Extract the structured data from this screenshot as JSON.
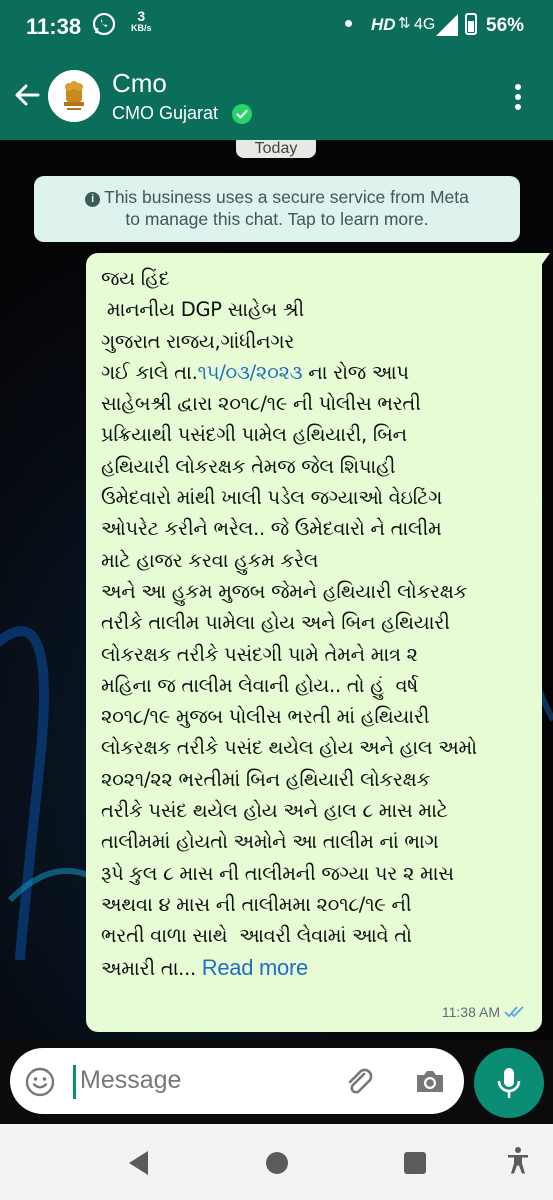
{
  "status_bar": {
    "time": "11:38",
    "net_speed_value": "3",
    "net_speed_unit": "KB/s",
    "hd": "HD",
    "network": "4G",
    "battery": "56%"
  },
  "header": {
    "title": "Cmo",
    "subtitle": "CMO Gujarat",
    "back_icon": "arrow-left-icon",
    "menu_icon": "more-vertical-icon"
  },
  "chat": {
    "date_chip": "Today",
    "notice": {
      "line1": "This business uses a secure service from Meta",
      "line2": "to manage this chat. Tap to learn more."
    },
    "message": {
      "lines": [
        "જય હિંદ",
        " માનનીય DGP સાહેબ શ્રી",
        "ગુજરાત રાજય,ગાંધીનગર",
        "ગઈ કાલે તા.",
        "૧૫/૦૩/૨૦૨૩",
        " ના રોજ આપ",
        "સાહેબશ્રી દ્વારા ૨૦૧૮/૧૯ ની પોલીસ ભરતી",
        "પ્રક્રિયાથી પસંદગી પામેલ હથિયારી, બિન",
        "હથિયારી લોકરક્ષક તેમજ જેલ શિપાહી",
        "ઉમેદવારો માંથી ખાલી પડેલ જગ્યાઓ વેઇટિંગ",
        "ઓપરેટ કરીને ભરેલ.. જે ઉમેદવારો ને તાલીમ",
        "માટે હાજર કરવા હુકમ કરેલ",
        "અને આ હુકમ મુજબ જેમને હથિયારી લોકરક્ષક",
        "તરીકે તાલીમ પામેલા હોય અને બિન હથિયારી",
        "લોકરક્ષક તરીકે પસંદગી પામે તેમને માત્ર ૨",
        "મહિના જ તાલીમ લેવાની હોય.. તો હું  વર્ષ",
        "૨૦૧૮/૧૯ મુજબ પોલીસ ભરતી માં હથિયારી",
        "લોકરક્ષક તરીકે પસંદ થયેલ હોય અને હાલ અમો",
        "૨૦૨૧/૨૨ ભરતીમાં બિન હથિયારી લોકરક્ષક",
        "તરીકે પસંદ થયેલ હોય અને હાલ ૮ માસ માટે",
        "તાલીમમાં હોયતો અમોને આ તાલીમ નાં ભાગ",
        "રૂપે કુલ ૮ માસ ની તાલીમની જગ્યા પર ૨ માસ",
        "અથવા ૪ માસ ની તાલીમમા ૨૦૧૮/૧૯ ની",
        "ભરતી વાળા સાથે  આવરી લેવામાં આવે તો",
        "અમારી તા... "
      ],
      "read_more": "Read more",
      "time": "11:38 AM"
    }
  },
  "input": {
    "placeholder": "Message"
  },
  "colors": {
    "header_bg": "#0b6e5a",
    "bubble_bg": "#e7fcd5",
    "link": "#1f6fc2",
    "mic_bg": "#0b8c74"
  }
}
